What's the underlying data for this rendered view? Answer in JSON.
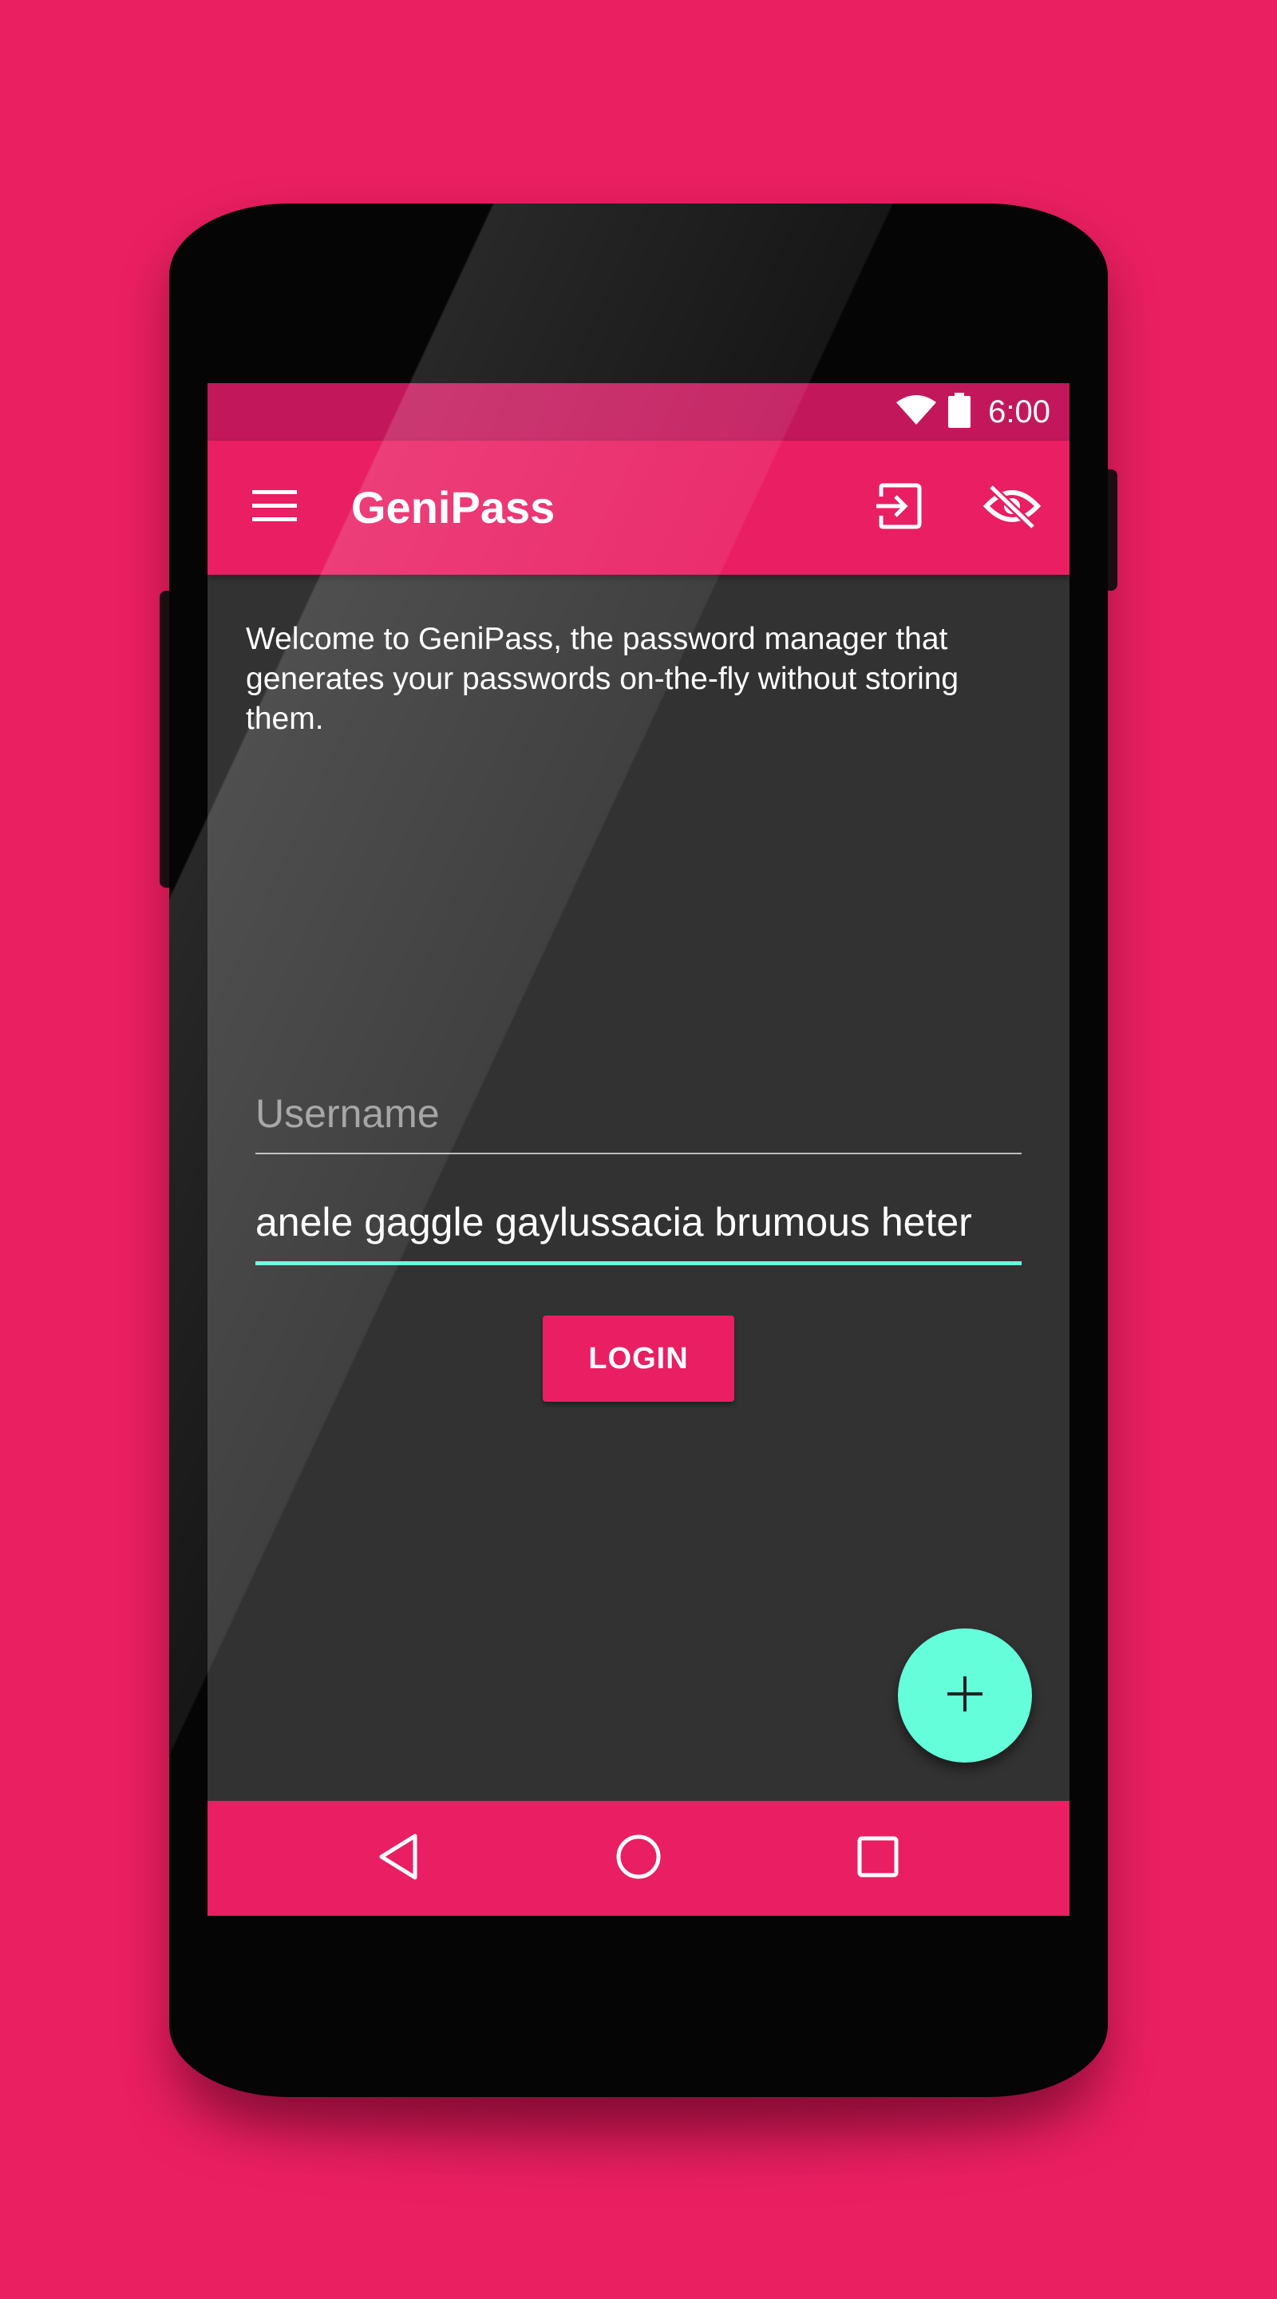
{
  "status_bar": {
    "time": "6:00",
    "icons": [
      "wifi-icon",
      "battery-icon"
    ]
  },
  "app_bar": {
    "title": "GeniPass",
    "menu_icon": "menu-icon",
    "actions": [
      "login-icon",
      "visibility-off-icon"
    ]
  },
  "main": {
    "welcome_text": "Welcome to GeniPass, the password manager that generates your passwords on-the-fly without storing them.",
    "username": {
      "value": "",
      "placeholder": "Username"
    },
    "password": {
      "value": "anele gaggle gaylussacia brumous heter"
    },
    "login_label": "LOGIN",
    "fab_icon": "plus-icon"
  },
  "nav_bar": {
    "buttons": [
      "back-icon",
      "home-icon",
      "recents-icon"
    ]
  },
  "colors": {
    "background": "#EA1F62",
    "primary": "#E91E63",
    "primary_dark": "#C2185B",
    "accent": "#64FFDA",
    "surface": "#323232"
  }
}
